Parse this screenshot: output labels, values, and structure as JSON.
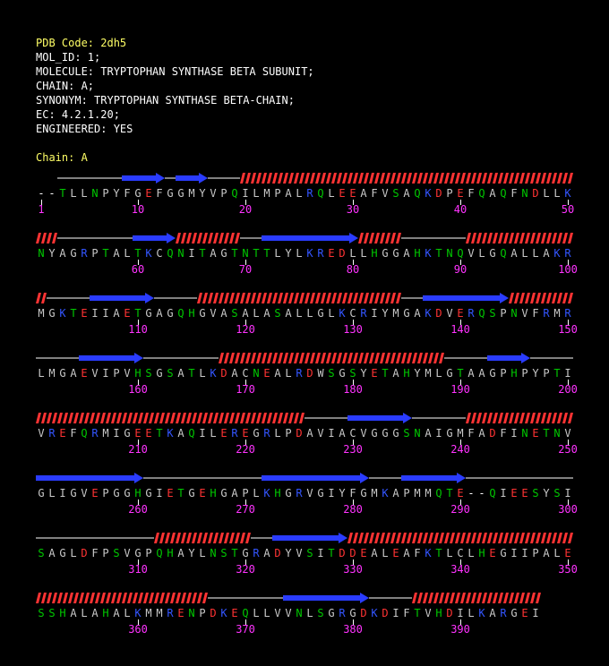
{
  "header": {
    "pdb_code": "PDB Code: 2dh5",
    "mol_id": "MOL_ID: 1;",
    "molecule": "MOLECULE: TRYPTOPHAN SYNTHASE BETA SUBUNIT;",
    "chain_line": "CHAIN: A;",
    "synonym": "SYNONYM: TRYPTOPHAN SYNTHASE BETA-CHAIN;",
    "ec": "EC: 4.2.1.20;",
    "engineered": "ENGINEERED: YES"
  },
  "chain_label": "Chain: A",
  "colors": {
    "hydrophobic": "#c8c8c8",
    "polar": "#00c800",
    "acidic": "#ff3333",
    "basic": "#3355ff",
    "gap": "#ffffff",
    "helix": "#ff3333",
    "strand": "#2a3cff",
    "coil": "#ffffff",
    "number": "#ff33ff"
  },
  "rows": [
    {
      "sequence": "--TLLNPYFGEFGGMYVPQILMPALRQLEEAFVSAQKDPEFQAQFNDLLK",
      "numbers": [
        "1",
        "10",
        "20",
        "30",
        "40",
        "50"
      ],
      "ss": "  CCCCCCEEEECEEECCCHHHHHHHHHHHHHHHHHHHHHHHHHHHHHHHHH"
    },
    {
      "sequence": "NYAGRPTALTKCQNITAGTNTTLYLKREDLLHGGAHKTNQVLGQALLAKR",
      "numbers": [
        "60",
        "70",
        "80",
        "90",
        "100"
      ],
      "ss": "HHCCCCCCCEEEEHHHHHHCCEEEEEEEEEHHHHCCCCCCHHHHHHHHHHH"
    },
    {
      "sequence": "MGKTEIIAETGAGQHGVASALASALLGLKCRIYMGAKDVERQSPNVFRMR",
      "numbers": [
        "110",
        "120",
        "130",
        "140",
        "150"
      ],
      "ss": "HCCCCEEEEEECCCCHHHHHHHHHHHHHHHHHHHCCEEEEEEEEHHHHHHHHHHHHHHHHHH"
    },
    {
      "sequence": "LMGAEVIPVHSGSATLKDACNEALRDWSGSYETAHYMLGTAAGPHPYPTI",
      "numbers": [
        "160",
        "170",
        "180",
        "190",
        "200"
      ],
      "ss": "CCCCEEEEEECCCCCCCHHHHHHHHHHHHHHHHHHHHHCCCCEEEECCCCCCCCCCCCHHHHHH"
    },
    {
      "sequence": "VREFQRMIGEETKAQILEREGRLPDAVIACVGGGSNAIGMFADFINETNV",
      "numbers": [
        "210",
        "220",
        "230",
        "240",
        "250"
      ],
      "ss": "HHHHHHHHHHHHHHHHHHHHHHHHHCCCCEEEEEECCCCCHHHHHHHHHHHHHHHCCCCCCC"
    },
    {
      "sequence": "GLIGVEPGGHGIETGEHGAPLKHGRVGIYFGMKAPMMQTE--QIEESYSI",
      "numbers": [
        "260",
        "270",
        "280",
        "290",
        "300"
      ],
      "ss": "EEEEEEEEEECCCCCCCCCCCEEEEEEEEEECCCEEEEEECCCCCCCCCC  CCCCCCCCC"
    },
    {
      "sequence": "SAGLDFPSVGPQHAYLNSTGRADYVSITDDEALEAFKTLCLHEGIIPALE",
      "numbers": [
        "310",
        "320",
        "330",
        "340",
        "350"
      ],
      "ss": "CCCCCCCCCCCHHHHHHHHHCCEEEEEEEHHHHHHHHHHHHHHHHHHHHHHHHHCCHHHHH"
    },
    {
      "sequence": "SSHALAHALKMMRENPDKEQLLVVNLSGRGDKDIFTVHDILKARGEI",
      "numbers": [
        "360",
        "370",
        "380",
        "390"
      ],
      "ss": "HHHHHHHHHHHHHHHHCCCCCCCEEEEEEEECCCCHHHHHHHHHHHHHHHHHHHHCCCCC"
    }
  ]
}
